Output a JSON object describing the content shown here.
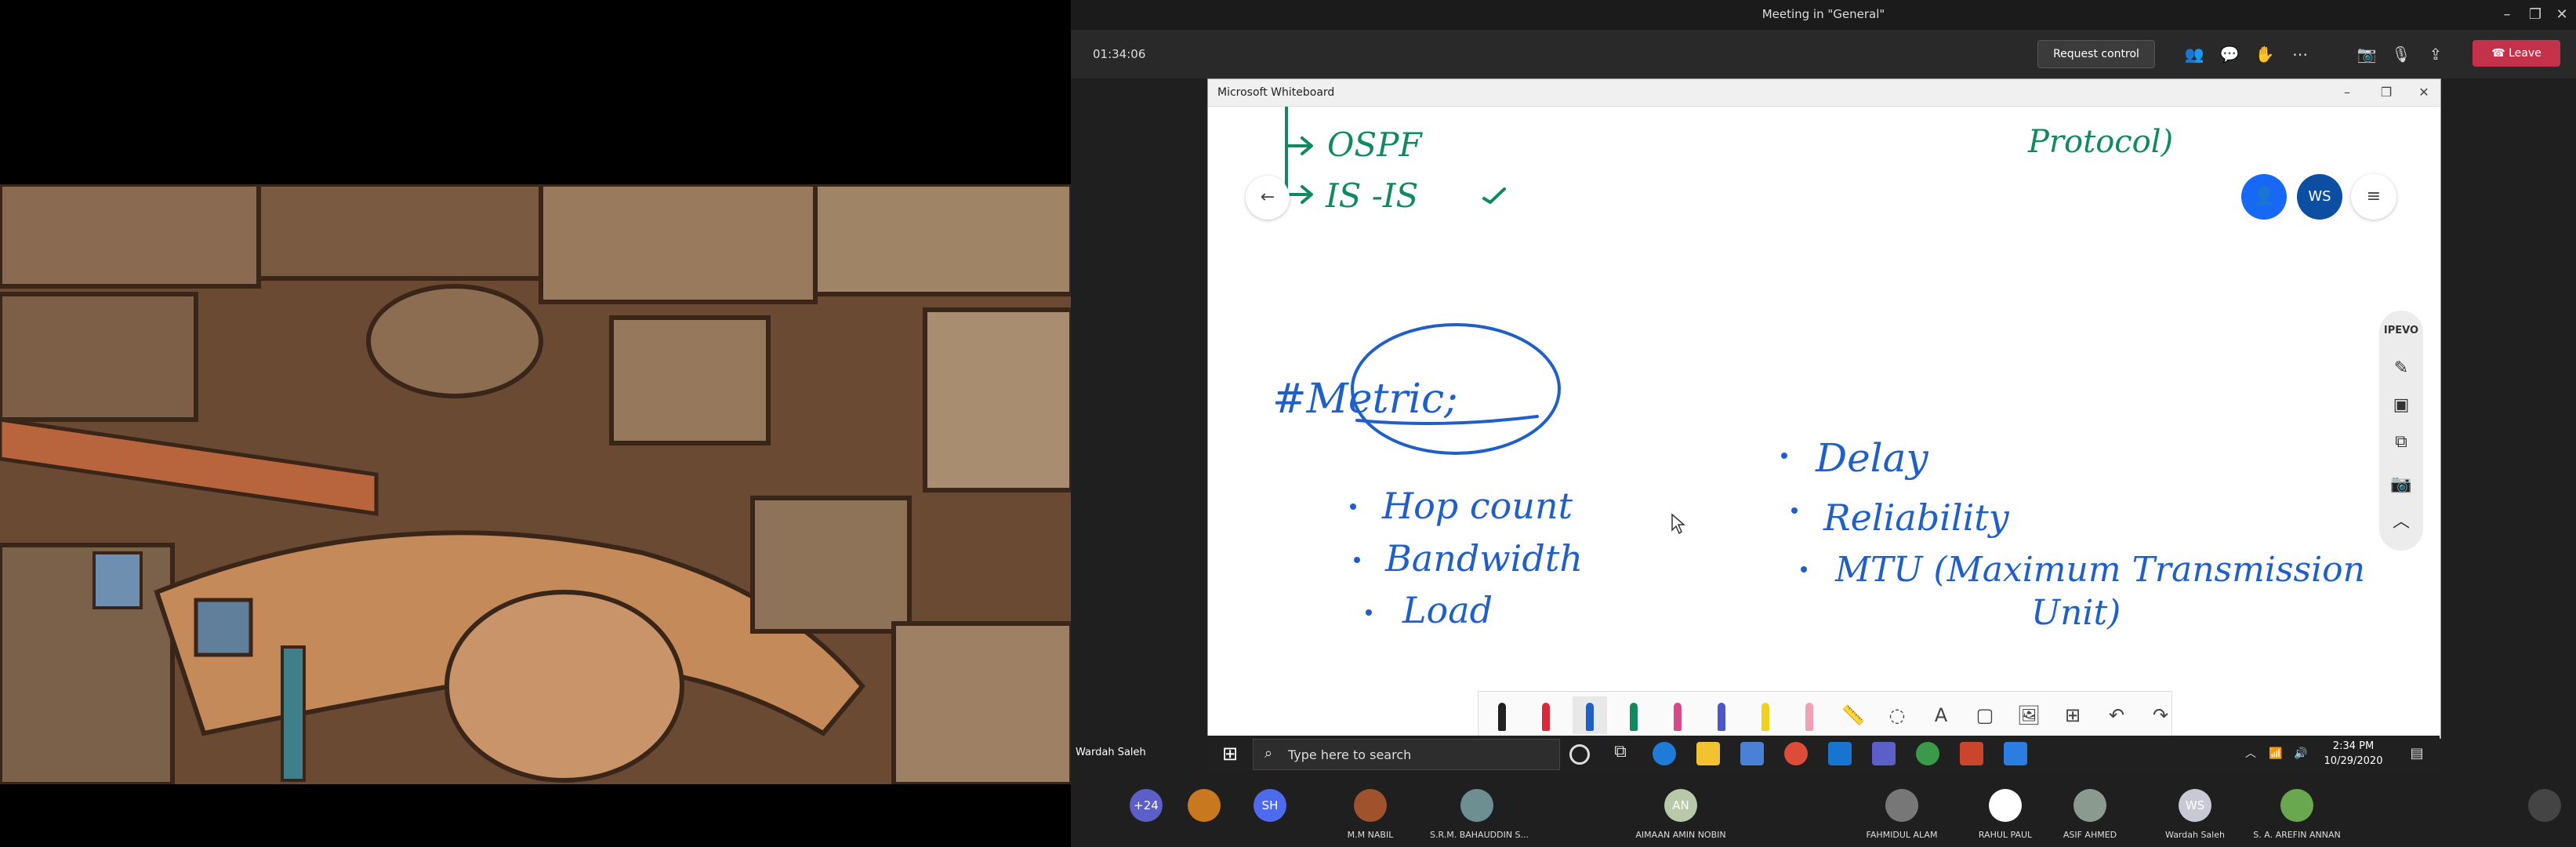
{
  "meeting": {
    "title": "Meeting in \"General\"",
    "timer": "01:34:06",
    "request_control": "Request control",
    "leave": "Leave"
  },
  "whiteboard": {
    "window_title": "Microsoft Whiteboard",
    "ink": {
      "ospf": "OSPF",
      "isis": "IS -IS",
      "protocol": "Protocol)",
      "metric": "#Metric;",
      "hop_count": "Hop count",
      "bandwidth": "Bandwidth",
      "load": "Load",
      "delay": "Delay",
      "reliability": "Reliability",
      "mtu": "MTU (Maximum Transmission",
      "unit": "Unit)"
    },
    "avatar_initials": "WS",
    "side_panel_label": "IPEVO"
  },
  "taskbar": {
    "search_placeholder": "Type here to search",
    "time": "2:34 PM",
    "date": "10/29/2020"
  },
  "presenter_name": "Wardah Saleh",
  "participants": [
    {
      "initials": "+24",
      "name": "",
      "color": "#5b5fc7"
    },
    {
      "initials": "",
      "name": "",
      "color": "#c8791f"
    },
    {
      "initials": "SH",
      "name": "",
      "color": "#4f6bed"
    },
    {
      "initials": "",
      "name": "M.M NABIL",
      "color": "#a0522d"
    },
    {
      "initials": "",
      "name": "S.R.M. BAHAUDDIN S...",
      "color": "#6d8f92"
    },
    {
      "initials": "AN",
      "name": "AIMAAN AMIN NOBIN",
      "color": "#b7c9a8"
    },
    {
      "initials": "",
      "name": "FAHMIDUL ALAM",
      "color": "#777777"
    },
    {
      "initials": "",
      "name": "RAHUL PAUL",
      "color": "#ffffff"
    },
    {
      "initials": "",
      "name": "ASIF AHMED",
      "color": "#8a9a8e"
    },
    {
      "initials": "WS",
      "name": "Wardah Saleh",
      "color": "#c9c9d6"
    },
    {
      "initials": "",
      "name": "S. A. AREFIN ANNAN",
      "color": "#6aa84f"
    },
    {
      "initials": "",
      "name": "",
      "color": "#444444"
    }
  ]
}
